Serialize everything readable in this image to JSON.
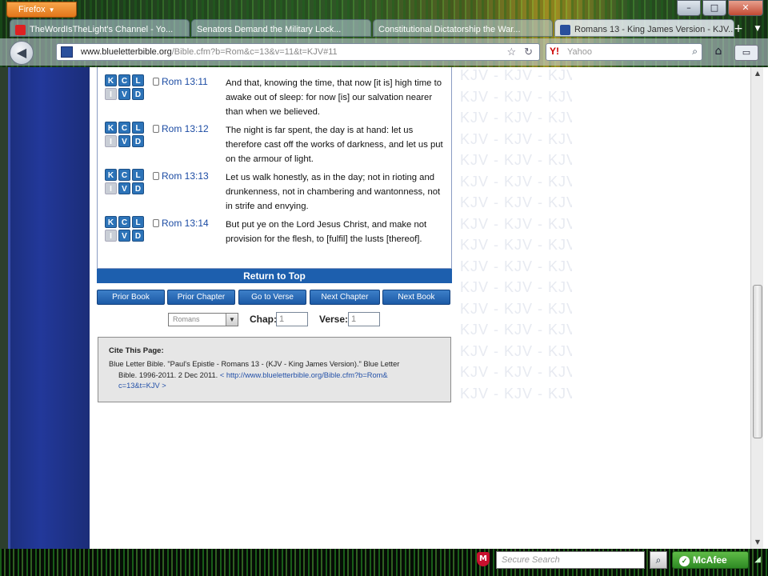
{
  "browser": {
    "app_button": "Firefox",
    "tabs": [
      {
        "label": "TheWordIsTheLight's Channel - Yo...",
        "icon": "youtube-icon"
      },
      {
        "label": "Senators Demand the Military Lock...",
        "icon": "page-icon"
      },
      {
        "label": "Constitutional Dictatorship the War...",
        "icon": "page-icon"
      },
      {
        "label": "Romans 13 - King James Version - KJV...",
        "icon": "blb-icon"
      }
    ],
    "url_domain": "www.blueletterbible.org",
    "url_path": "/Bible.cfm?b=Rom&c=13&v=11&t=KJV#11",
    "search_engine": "Y!",
    "search_placeholder": "Yahoo",
    "window_buttons": {
      "minimize": "–",
      "maximize": "□",
      "close": "✕"
    },
    "new_tab": "+",
    "tab_list": "▼"
  },
  "verses": [
    {
      "ref": "Rom 13:11",
      "text": "And that, knowing the time, that now [it is] high time to awake out of sleep: for now [is] our salvation nearer than when we believed."
    },
    {
      "ref": "Rom 13:12",
      "text": "The night is far spent, the day is at hand: let us therefore cast off the works of darkness, and let us put on the armour of light."
    },
    {
      "ref": "Rom 13:13",
      "text": "Let us walk honestly, as in the day; not in rioting and drunkenness, not in chambering and wantonness, not in strife and envying."
    },
    {
      "ref": "Rom 13:14",
      "text": "But put ye on the Lord Jesus Christ, and make not provision for the flesh, to [fulfil] the lusts [thereof]."
    }
  ],
  "verse_buttons": {
    "k": "K",
    "c": "C",
    "l": "L",
    "i": "I",
    "v": "V",
    "d": "D"
  },
  "watermark_text": "KJV - KJV - KJV",
  "return_to_top": "Return to Top",
  "nav_buttons": [
    "Prior Book",
    "Prior Chapter",
    "Go to Verse",
    "Next Chapter",
    "Next Book"
  ],
  "selector": {
    "book": "Romans",
    "chap_label": "Chap:",
    "chap_value": "1",
    "verse_label": "Verse:",
    "verse_value": "1"
  },
  "cite": {
    "title": "Cite This Page:",
    "line1": "Blue Letter Bible. \"Paul's Epistle - Romans 13 - (KJV - King James Version).\" Blue Letter",
    "line2": "Bible. 1996-2011. 2 Dec 2011. ",
    "link1": "< http://www.blueletterbible.org/Bible.cfm?b=Rom&",
    "link2": "c=13&t=KJV >"
  },
  "bottom": {
    "search_placeholder": "Secure Search",
    "mcafee_label": "McAfee"
  },
  "colors": {
    "left_bar": "#22389a",
    "return_top": "#1d5fae",
    "verse_ref": "#1b4ba3"
  }
}
